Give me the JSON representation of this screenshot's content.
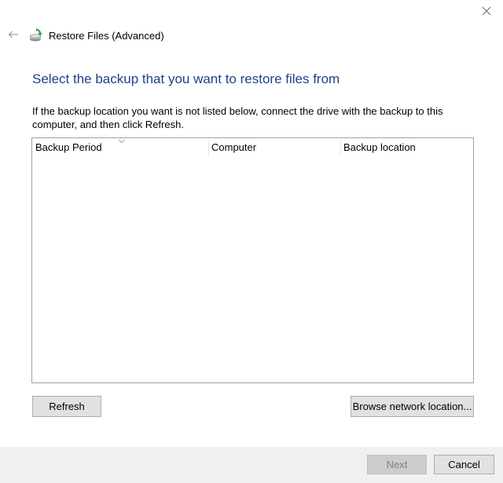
{
  "window": {
    "title": "Restore Files (Advanced)",
    "close_glyph": "✕"
  },
  "icons": {
    "back": "back-arrow-icon",
    "app": "backup-restore-icon",
    "close": "close-icon",
    "sort": "chevron-down-icon"
  },
  "main": {
    "heading": "Select the backup that you want to restore files from",
    "instructions": "If the backup location you want is not listed below, connect the drive with the backup to this computer, and then click Refresh."
  },
  "list": {
    "columns": [
      {
        "label": "Backup Period"
      },
      {
        "label": "Computer"
      },
      {
        "label": "Backup location"
      }
    ],
    "rows": []
  },
  "buttons": {
    "refresh": "Refresh",
    "browse": "Browse network location...",
    "next": "Next",
    "cancel": "Cancel"
  },
  "colors": {
    "heading": "#1f3f8c",
    "footer_bg": "#f0f0f0",
    "button_bg": "#e1e1e1",
    "disabled_text": "#838383"
  }
}
